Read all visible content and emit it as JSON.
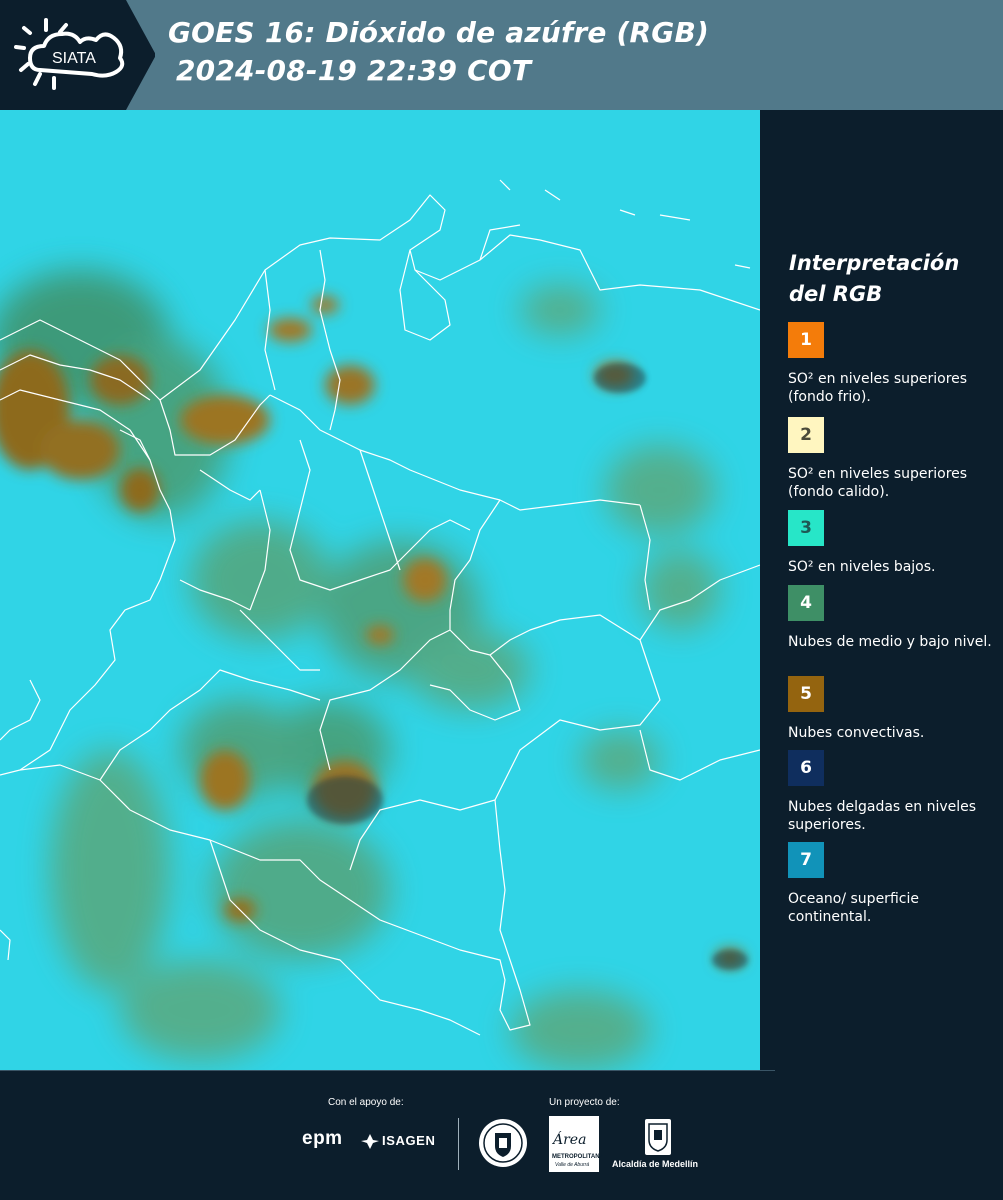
{
  "header": {
    "logo_text": "SIATA",
    "title_line1": "GOES 16: Dióxido de azúfre (RGB)",
    "title_line2": "2024-08-19 22:39 COT",
    "background_color": "#51798a",
    "logo_color": "#0c1e2c"
  },
  "legend": {
    "title": "Interpretación del RGB",
    "items": [
      {
        "number": "1",
        "label": "SO² en niveles superiores (fondo frio).",
        "color": "#f47c0a",
        "number_color": "#ffffff"
      },
      {
        "number": "2",
        "label": "SO² en niveles superiores (fondo calido).",
        "color": "#fff6c0",
        "number_color": "#4a4a3a"
      },
      {
        "number": "3",
        "label": "SO² en niveles bajos.",
        "color": "#27e6c8",
        "number_color": "#1e5a55"
      },
      {
        "number": "4",
        "label": "Nubes de medio y bajo nivel.",
        "color": "#3e8f66",
        "number_color": "#ffffff"
      },
      {
        "number": "5",
        "label": "Nubes convectivas.",
        "color": "#94640f",
        "number_color": "#ffffff"
      },
      {
        "number": "6",
        "label": "Nubes delgadas en niveles superiores.",
        "color": "#0f2e5e",
        "number_color": "#ffffff"
      },
      {
        "number": "7",
        "label": "Oceano/ superficie continental.",
        "color": "#1193b9",
        "number_color": "#ffffff"
      }
    ]
  },
  "map": {
    "background_color": "#2fd3e6",
    "boundary_color": "#ffffff"
  },
  "footer": {
    "support_label": "Con el apoyo de:",
    "project_label": "Un proyecto de:",
    "sponsor_1": "epm",
    "sponsor_2": "ISAGEN",
    "partner_area_name": "Área",
    "partner_area_sub1": "METROPOLITANA",
    "partner_area_sub2": "Valle de Aburrá",
    "partner_alcaldia": "Alcaldía de Medellín"
  }
}
